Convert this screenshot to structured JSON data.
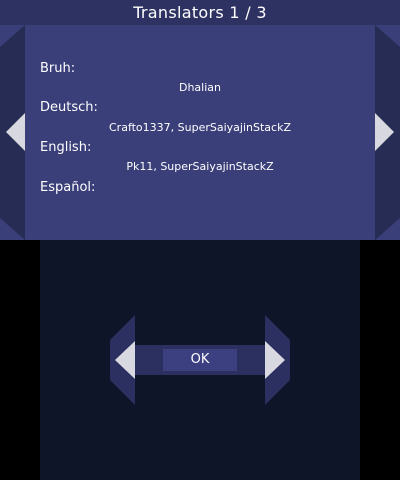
{
  "header": {
    "title": "Translators 1 / 3"
  },
  "translators": [
    {
      "language": "Bruh:",
      "names": "Dhalian"
    },
    {
      "language": "Deutsch:",
      "names": "Crafto1337, SuperSaiyajinStackZ"
    },
    {
      "language": "English:",
      "names": "Pk11, SuperSaiyajinStackZ"
    },
    {
      "language": "Español:",
      "names": ""
    }
  ],
  "bottom": {
    "ok_label": "OK"
  },
  "icons": {
    "prev_page": "arrow-left-icon",
    "next_page": "arrow-right-icon",
    "bottom_prev": "arrow-left-icon",
    "bottom_next": "arrow-right-icon"
  },
  "colors": {
    "panel": "#3a3f7a",
    "title_bar": "#2e3262",
    "side_bar": "#272c54",
    "arrow": "#d8d8e0",
    "bottom_bg": "#0f1528",
    "button": "#3c4080"
  }
}
